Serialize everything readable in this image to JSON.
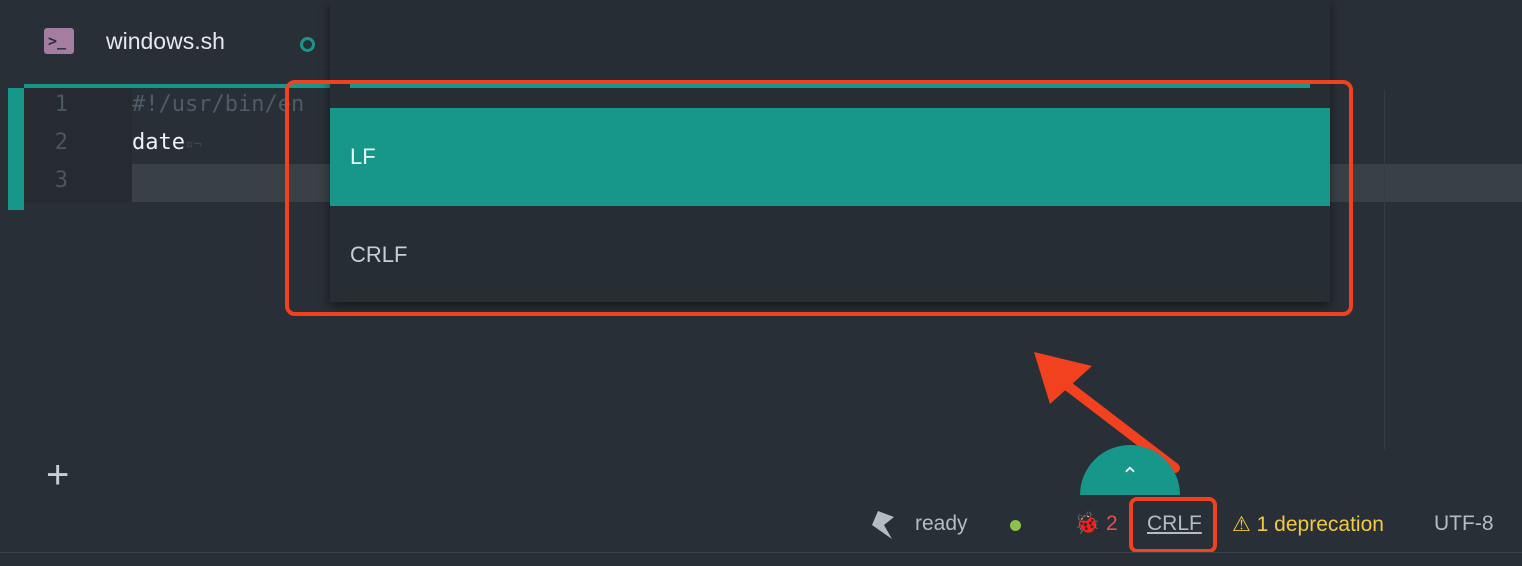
{
  "tab": {
    "title": "windows.sh",
    "icon": "terminal-icon",
    "modified": true
  },
  "editor": {
    "lines": [
      {
        "number": "1",
        "text": "#!/usr/bin/en"
      },
      {
        "number": "2",
        "text": "date",
        "invisibles": "¤¬"
      },
      {
        "number": "3",
        "text": ""
      }
    ]
  },
  "line_ending_dropdown": {
    "options": [
      "LF",
      "CRLF"
    ],
    "selected": "LF"
  },
  "add_button": "+",
  "status_bar": {
    "ready": "ready",
    "errors": "2",
    "line_ending": "CRLF",
    "deprecation": "1 deprecation",
    "encoding": "UTF-8"
  },
  "colors": {
    "accent": "#16978a",
    "error": "#e05252",
    "warning": "#f3c944",
    "status_dot": "#8bc34a",
    "annotation": "#f2411e"
  }
}
